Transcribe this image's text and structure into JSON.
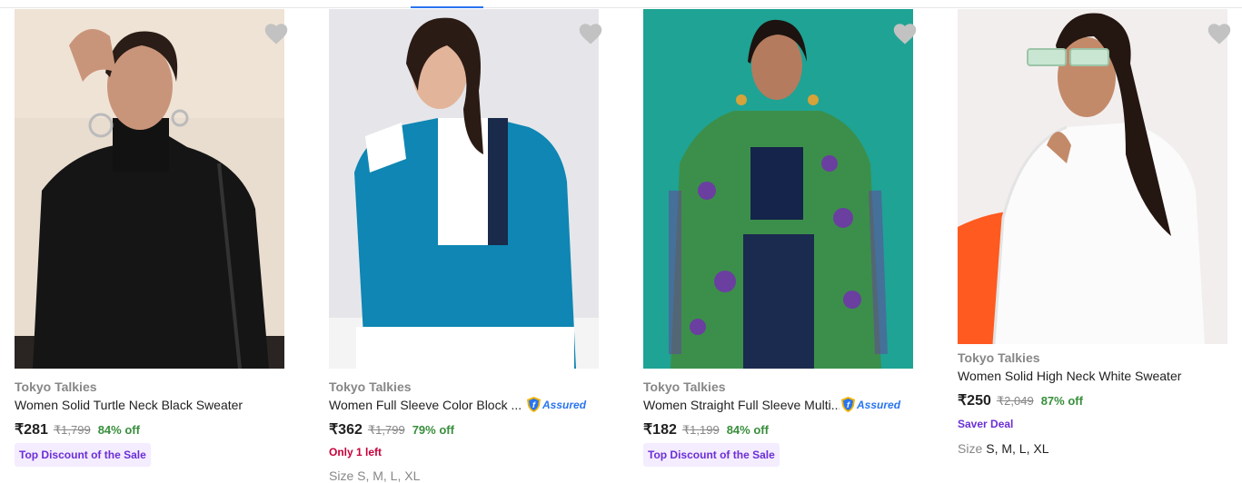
{
  "products": [
    {
      "brand": "Tokyo Talkies",
      "title": "Women Solid Turtle Neck Black Sweater",
      "price": "₹281",
      "mrp": "₹1,799",
      "discount": "84% off",
      "badge": "Top Discount of the Sale",
      "image_icon": "black-turtle-neck-sweater-photo"
    },
    {
      "brand": "Tokyo Talkies",
      "title": "Women Full Sleeve Color Block ...",
      "assured": "Assured",
      "price": "₹362",
      "mrp": "₹1,799",
      "discount": "79% off",
      "stock_note": "Only 1 left",
      "sizes_partial": "Size S, M, L, XL",
      "image_icon": "teal-color-block-sweatshirt-photo"
    },
    {
      "brand": "Tokyo Talkies",
      "title": "Women Straight Full Sleeve Multi...",
      "assured": "Assured",
      "price": "₹182",
      "mrp": "₹1,199",
      "discount": "84% off",
      "badge": "Top Discount of the Sale",
      "image_icon": "floral-shrug-photo"
    },
    {
      "brand": "Tokyo Talkies",
      "title": "Women Solid High Neck White Sweater",
      "price": "₹250",
      "mrp": "₹2,049",
      "discount": "87% off",
      "deal": "Saver Deal",
      "sizes_label": "Size",
      "sizes": "S, M, L, XL",
      "image_icon": "white-high-neck-sweater-photo"
    }
  ],
  "colors": {
    "accent": "#2874f0",
    "discount_green": "#388e3c",
    "badge_purple": "#6b2fd6",
    "stock_red": "#c7003b",
    "wishlist_gray": "#c2c2c2"
  }
}
